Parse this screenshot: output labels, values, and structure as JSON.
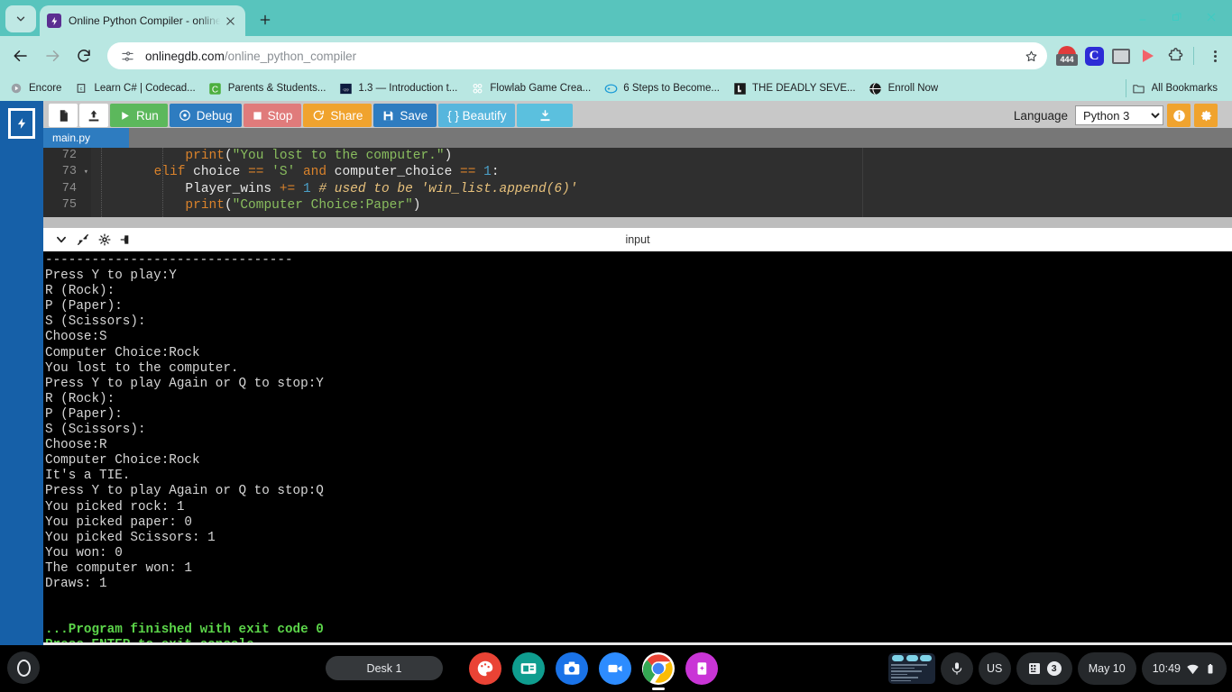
{
  "browser": {
    "tab": {
      "title": "Online Python Compiler - online",
      "favicon": "lightning-bolt-icon"
    },
    "url_host": "onlinegdb.com",
    "url_path": "/online_python_compiler",
    "window_controls": [
      "minimize",
      "maximize",
      "close"
    ],
    "extensions": [
      {
        "name": "house-badge-extension",
        "badge": "444"
      },
      {
        "name": "c-extension"
      },
      {
        "name": "print-extension"
      },
      {
        "name": "red-arrow-extension"
      },
      {
        "name": "puzzle-extensions-icon"
      }
    ],
    "bookmarks": [
      {
        "label": "Encore",
        "icon": "play-circle-icon"
      },
      {
        "label": "Learn C# | Codecad...",
        "icon": "codecademy-icon"
      },
      {
        "label": "Parents & Students...",
        "icon": "clever-c-icon"
      },
      {
        "label": "1.3 — Introduction t...",
        "icon": "cpp-icon"
      },
      {
        "label": "Flowlab Game Crea...",
        "icon": "flowlab-icon"
      },
      {
        "label": "6 Steps to Become...",
        "icon": "gamepad-icon"
      },
      {
        "label": "THE DEADLY SEVE...",
        "icon": "dark-doc-icon"
      },
      {
        "label": "Enroll Now",
        "icon": "globe-icon"
      }
    ],
    "all_bookmarks_label": "All Bookmarks"
  },
  "ide": {
    "toolbar": {
      "new_file_label": "new-file",
      "upload_label": "upload",
      "run_label": "Run",
      "debug_label": "Debug",
      "stop_label": "Stop",
      "share_label": "Share",
      "save_label": "Save",
      "beautify_label": "{ } Beautify",
      "download_label": "download",
      "language_label": "Language",
      "language_value": "Python 3",
      "info_label": "info",
      "settings_label": "settings"
    },
    "file_tab": "main.py",
    "editor": {
      "lines": [
        {
          "number": "72",
          "foldable": false,
          "tokens": [
            {
              "t": "            ",
              "c": "k-id"
            },
            {
              "t": "print",
              "c": "k-fn"
            },
            {
              "t": "(",
              "c": "k-id"
            },
            {
              "t": "\"You lost to the computer.\"",
              "c": "k-str"
            },
            {
              "t": ")",
              "c": "k-id"
            }
          ]
        },
        {
          "number": "73",
          "foldable": true,
          "tokens": [
            {
              "t": "        ",
              "c": "k-id"
            },
            {
              "t": "elif",
              "c": "k-kw"
            },
            {
              "t": " choice ",
              "c": "k-id"
            },
            {
              "t": "==",
              "c": "k-op"
            },
            {
              "t": " ",
              "c": "k-id"
            },
            {
              "t": "'S'",
              "c": "k-str"
            },
            {
              "t": " ",
              "c": "k-id"
            },
            {
              "t": "and",
              "c": "k-kw"
            },
            {
              "t": " computer_choice ",
              "c": "k-id"
            },
            {
              "t": "==",
              "c": "k-op"
            },
            {
              "t": " ",
              "c": "k-id"
            },
            {
              "t": "1",
              "c": "k-num"
            },
            {
              "t": ":",
              "c": "k-id"
            }
          ]
        },
        {
          "number": "74",
          "foldable": false,
          "tokens": [
            {
              "t": "            Player_wins ",
              "c": "k-id"
            },
            {
              "t": "+=",
              "c": "k-op"
            },
            {
              "t": " ",
              "c": "k-id"
            },
            {
              "t": "1",
              "c": "k-num"
            },
            {
              "t": " ",
              "c": "k-id"
            },
            {
              "t": "# used to be 'win_list.append(6)'",
              "c": "k-com"
            }
          ]
        },
        {
          "number": "75",
          "foldable": false,
          "tokens": [
            {
              "t": "            ",
              "c": "k-id"
            },
            {
              "t": "print",
              "c": "k-fn"
            },
            {
              "t": "(",
              "c": "k-id"
            },
            {
              "t": "\"Computer Choice:Paper\"",
              "c": "k-str"
            },
            {
              "t": ")",
              "c": "k-id"
            }
          ]
        }
      ]
    },
    "console": {
      "header_title": "input",
      "header_icons": [
        "chevron-down-icon",
        "collapse-arrows-icon",
        "gear-icon",
        "clear-console-icon"
      ],
      "output": [
        {
          "text": "--------------------------------",
          "ok": false
        },
        {
          "text": "Press Y to play:Y",
          "ok": false
        },
        {
          "text": "R (Rock):",
          "ok": false
        },
        {
          "text": "P (Paper):",
          "ok": false
        },
        {
          "text": "S (Scissors):",
          "ok": false
        },
        {
          "text": "Choose:S",
          "ok": false
        },
        {
          "text": "Computer Choice:Rock",
          "ok": false
        },
        {
          "text": "You lost to the computer.",
          "ok": false
        },
        {
          "text": "Press Y to play Again or Q to stop:Y",
          "ok": false
        },
        {
          "text": "R (Rock):",
          "ok": false
        },
        {
          "text": "P (Paper):",
          "ok": false
        },
        {
          "text": "S (Scissors):",
          "ok": false
        },
        {
          "text": "Choose:R",
          "ok": false
        },
        {
          "text": "Computer Choice:Rock",
          "ok": false
        },
        {
          "text": "It's a TIE.",
          "ok": false
        },
        {
          "text": "Press Y to play Again or Q to stop:Q",
          "ok": false
        },
        {
          "text": "You picked rock: 1",
          "ok": false
        },
        {
          "text": "You picked paper: 0",
          "ok": false
        },
        {
          "text": "You picked Scissors: 1",
          "ok": false
        },
        {
          "text": "You won: 0",
          "ok": false
        },
        {
          "text": "The computer won: 1",
          "ok": false
        },
        {
          "text": "Draws: 1",
          "ok": false
        },
        {
          "text": " ",
          "ok": false
        },
        {
          "text": " ",
          "ok": false
        },
        {
          "text": "...Program finished with exit code 0",
          "ok": true
        },
        {
          "text": "Press ENTER to exit console.",
          "ok": true
        }
      ]
    }
  },
  "shelf": {
    "launcher_label": "launcher",
    "desk_label": "Desk 1",
    "apps": [
      {
        "name": "paint-app-icon",
        "color": "#ea4335"
      },
      {
        "name": "slides-app-icon",
        "color": "#0f9d8f"
      },
      {
        "name": "camera-app-icon",
        "color": "#1a73e8"
      },
      {
        "name": "zoom-app-icon",
        "color": "#2d8cff"
      },
      {
        "name": "chrome-app-icon",
        "color": "#ffffff",
        "active": true
      },
      {
        "name": "cards-app-icon",
        "color": "#c935d6"
      }
    ],
    "status": {
      "mic_label": "microphone",
      "keyboard_layout": "US",
      "window_count": "3",
      "date": "May 10",
      "time": "10:49",
      "network": "wifi",
      "battery": "battery-full"
    }
  },
  "colors": {
    "browser_bg": "#58c4bd",
    "toolbar_bg": "#b9e7e2",
    "accent_blue": "#1660a8",
    "run_green": "#5cb85c",
    "console_green": "#5cd64a"
  }
}
